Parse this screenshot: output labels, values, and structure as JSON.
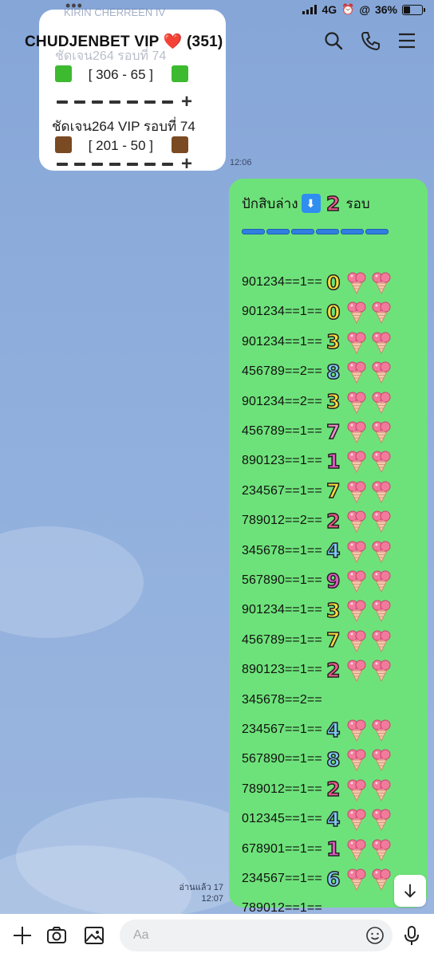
{
  "status_bar": {
    "faded_contact": "KIRIN CHERREEN IV",
    "network": "4G",
    "battery": "36%",
    "battery_level": 0.36
  },
  "header": {
    "title": "CHUDJENBET VIP ❤️ (351)",
    "icons": [
      "search-icon",
      "phone-icon",
      "menu-icon"
    ]
  },
  "incoming": {
    "faded_text": "ชัดเจน264 รอบที่ 74",
    "line1": "[ 306 - 65 ]",
    "line2": "ชัดเจน264 VIP รอบที่ 74",
    "line3": "[ 201 - 50 ]",
    "time": "12:06",
    "colors": {
      "green": "#3dba2f",
      "brown": "#7a4a22"
    }
  },
  "outgoing": {
    "header_text": "ปักสิบล่าง",
    "header_num": "2",
    "header_suffix": "รอบ",
    "bubble_color": "#6ee27a",
    "rows": [
      {
        "text": "901234==1==",
        "num": "0",
        "color": "#f7dc3a",
        "cones": 2
      },
      {
        "text": "901234==1==",
        "num": "0",
        "color": "#f7dc3a",
        "cones": 2
      },
      {
        "text": "901234==1==",
        "num": "3",
        "color": "#f7dc3a",
        "cones": 2
      },
      {
        "text": "456789==2==",
        "num": "8",
        "color": "#7cc8f5",
        "cones": 2
      },
      {
        "text": "901234==2==",
        "num": "3",
        "color": "#f7dc3a",
        "cones": 2
      },
      {
        "text": "456789==1==",
        "num": "7",
        "color": "#f28fd0",
        "cones": 2
      },
      {
        "text": "890123==1==",
        "num": "1",
        "color": "#e158c6",
        "cones": 2
      },
      {
        "text": "234567==1==",
        "num": "7",
        "color": "#f7dc3a",
        "cones": 2
      },
      {
        "text": "789012==2==",
        "num": "2",
        "color": "#f05a8c",
        "cones": 2
      },
      {
        "text": "345678==1==",
        "num": "4",
        "color": "#7cc8f5",
        "cones": 2
      },
      {
        "text": "567890==1==",
        "num": "9",
        "color": "#e158c6",
        "cones": 2
      },
      {
        "text": "901234==1==",
        "num": "3",
        "color": "#f7dc3a",
        "cones": 2
      },
      {
        "text": "456789==1==",
        "num": "7",
        "color": "#f7dc3a",
        "cones": 2
      },
      {
        "text": "890123==1==",
        "num": "2",
        "color": "#f05a8c",
        "cones": 2
      },
      {
        "text": "345678==2==",
        "num": "",
        "color": "#f7dc3a",
        "cones": 0
      },
      {
        "text": "234567==1==",
        "num": "4",
        "color": "#7cc8f5",
        "cones": 2
      },
      {
        "text": "567890==1==",
        "num": "8",
        "color": "#7cc8f5",
        "cones": 2
      },
      {
        "text": "789012==1==",
        "num": "2",
        "color": "#f05a8c",
        "cones": 2
      },
      {
        "text": "012345==1==",
        "num": "4",
        "color": "#7cc8f5",
        "cones": 2
      },
      {
        "text": "678901==1==",
        "num": "1",
        "color": "#e158c6",
        "cones": 2
      },
      {
        "text": "234567==1==",
        "num": "6",
        "color": "#7cc8f5",
        "cones": 2
      },
      {
        "text": "789012==1==",
        "num": "",
        "color": "#f7dc3a",
        "cones": 0
      }
    ]
  },
  "read_status": "อ่านแล้ว 17",
  "read_time": "12:07",
  "input": {
    "placeholder": "Aa"
  },
  "bottom_icons": [
    "plus-icon",
    "camera-icon",
    "image-icon",
    "emoji-icon",
    "mic-icon"
  ]
}
